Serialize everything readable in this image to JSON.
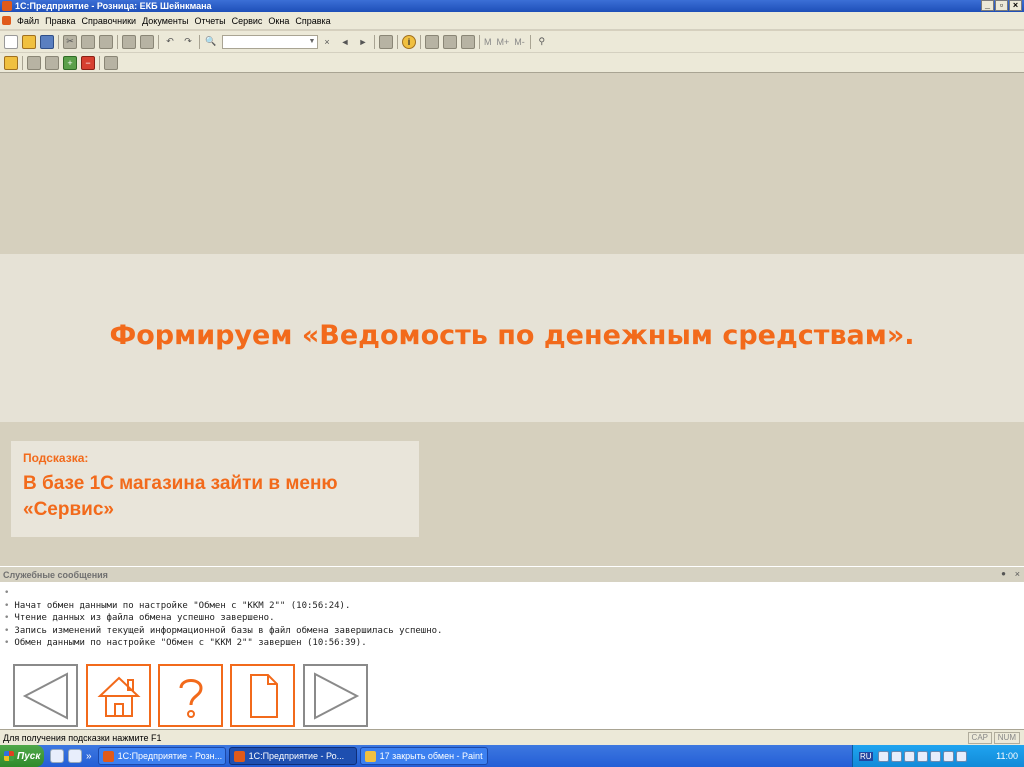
{
  "window": {
    "title": "1С:Предприятие - Розница: ЕКБ Шейнкмана",
    "controls": [
      "_",
      "▫",
      "×"
    ]
  },
  "menu": {
    "items": [
      "Файл",
      "Правка",
      "Справочники",
      "Документы",
      "Отчеты",
      "Сервис",
      "Окна",
      "Справка"
    ]
  },
  "toolbar": {
    "icons": [
      "new-document-icon",
      "open-folder-icon",
      "save-icon",
      "cut-icon",
      "copy-icon",
      "paste-icon",
      "print-icon",
      "preview-icon",
      "undo-icon",
      "redo-icon",
      "search-icon",
      "clear-icon",
      "back-icon",
      "forward-icon",
      "window-icon",
      "info-icon",
      "calculator-icon",
      "calendar-icon",
      "clipboard-icon",
      "memory-icon"
    ],
    "search_value": "",
    "memory_labels": [
      "M",
      "M+",
      "M-"
    ]
  },
  "slide": {
    "title": "Формируем «Ведомость по денежным средствам».",
    "hint_label": "Подсказка:",
    "hint_text": "В базе 1С магазина зайти в меню «Сервис»"
  },
  "messages": {
    "title": "Служебные сообщения",
    "lines": [
      "",
      "Начат обмен данными по настройке \"Обмен с \"ККМ 2\"\" (10:56:24).",
      "Чтение данных из файла обмена успешно завершено.",
      "Запись изменений текущей информационной базы в файл обмена завершилась успешно.",
      "Обмен данными по настройке \"Обмен с \"ККМ 2\"\" завершен (10:56:39)."
    ]
  },
  "nav_buttons": [
    "back-arrow-icon",
    "home-icon",
    "question-icon",
    "document-icon",
    "forward-arrow-icon"
  ],
  "statusbar": {
    "hint": "Для получения подсказки нажмите F1",
    "cap": "CAP",
    "num": "NUM"
  },
  "taskbar": {
    "start": "Пуск",
    "tasks": [
      {
        "label": "1С:Предприятие - Розн...",
        "active": false,
        "icon": "1c-icon"
      },
      {
        "label": "1С:Предприятие - Ро...",
        "active": true,
        "icon": "1c-icon"
      },
      {
        "label": "17 закрыть обмен - Paint",
        "active": false,
        "icon": "paint-icon"
      }
    ],
    "lang": "RU",
    "clock": "11:00"
  },
  "colors": {
    "accent": "#f26a1b",
    "content_bg": "#d6d0be",
    "banner_bg": "#e6e2d6",
    "taskbar": "#245ed6",
    "start": "#2f8a2a"
  }
}
